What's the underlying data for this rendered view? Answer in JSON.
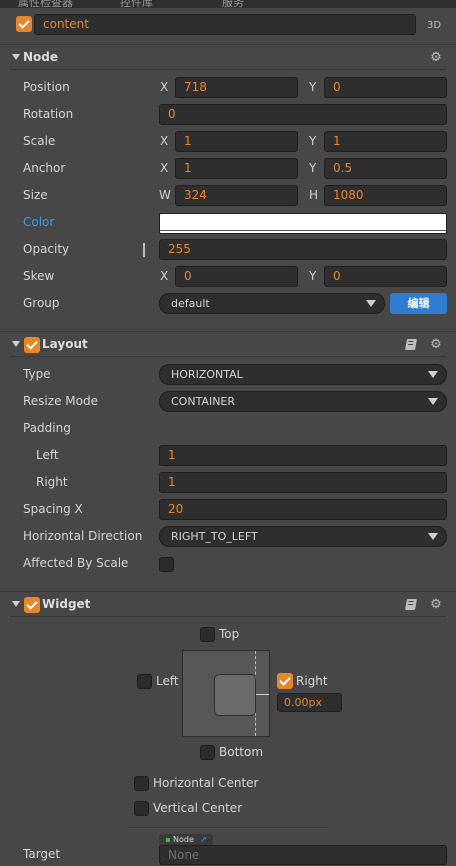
{
  "tabs": [
    "属性检查器",
    "控件库",
    "服务"
  ],
  "node_name": "content",
  "three_d_label": "3D",
  "node_section": {
    "title": "Node",
    "position": {
      "label": "Position",
      "x_label": "X",
      "x": "718",
      "y_label": "Y",
      "y": "0"
    },
    "rotation": {
      "label": "Rotation",
      "value": "0"
    },
    "scale": {
      "label": "Scale",
      "x_label": "X",
      "x": "1",
      "y_label": "Y",
      "y": "1"
    },
    "anchor": {
      "label": "Anchor",
      "x_label": "X",
      "x": "1",
      "y_label": "Y",
      "y": "0.5"
    },
    "size": {
      "label": "Size",
      "w_label": "W",
      "w": "324",
      "h_label": "H",
      "h": "1080"
    },
    "color": {
      "label": "Color",
      "value": "#ffffff"
    },
    "opacity": {
      "label": "Opacity",
      "value": "255"
    },
    "skew": {
      "label": "Skew",
      "x_label": "X",
      "x": "0",
      "y_label": "Y",
      "y": "0"
    },
    "group": {
      "label": "Group",
      "value": "default",
      "edit_label": "编辑"
    }
  },
  "layout_section": {
    "title": "Layout",
    "type": {
      "label": "Type",
      "value": "HORIZONTAL"
    },
    "resize_mode": {
      "label": "Resize Mode",
      "value": "CONTAINER"
    },
    "padding": {
      "label": "Padding"
    },
    "left": {
      "label": "Left",
      "value": "1"
    },
    "right": {
      "label": "Right",
      "value": "1"
    },
    "spacing_x": {
      "label": "Spacing X",
      "value": "20"
    },
    "horizontal_direction": {
      "label": "Horizontal Direction",
      "value": "RIGHT_TO_LEFT"
    },
    "affected_by_scale": {
      "label": "Affected By Scale"
    }
  },
  "widget_section": {
    "title": "Widget",
    "top_label": "Top",
    "left_label": "Left",
    "right_label": "Right",
    "right_value": "0.00px",
    "bottom_label": "Bottom",
    "horizontal_center_label": "Horizontal Center",
    "vertical_center_label": "Vertical Center",
    "target_label": "Target",
    "target_tag": "Node",
    "target_value": "None"
  },
  "colors": {
    "accent": "#e8862a",
    "edit_button": "#2f7dd1",
    "color_label": "#3d9be9"
  }
}
